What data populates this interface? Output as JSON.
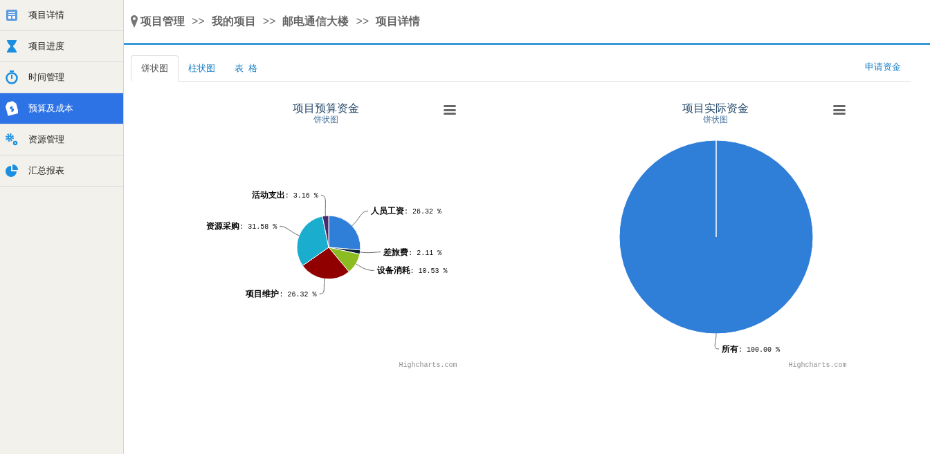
{
  "sidebar": {
    "items": [
      {
        "label": "项目详情",
        "selected": false
      },
      {
        "label": "项目进度",
        "selected": false
      },
      {
        "label": "时间管理",
        "selected": false
      },
      {
        "label": "预算及成本",
        "selected": true
      },
      {
        "label": "资源管理",
        "selected": false
      },
      {
        "label": "汇总报表",
        "selected": false
      }
    ]
  },
  "breadcrumb": {
    "items": [
      "项目管理",
      "我的项目",
      "邮电通信大楼",
      "项目详情"
    ],
    "separator": ">>"
  },
  "tabs": [
    {
      "label": "饼状图",
      "selected": true
    },
    {
      "label": "柱状图",
      "selected": false
    },
    {
      "label": "表  格",
      "selected": false
    }
  ],
  "apply_link": "申请资金",
  "charts": [
    {
      "subtitle": "饼状图",
      "credits": "Highcharts.com",
      "chart_data": {
        "type": "pie",
        "title": "项目预算资金",
        "data_labels": true,
        "categories": [
          "人员工资",
          "差旅费",
          "设备消耗",
          "项目维护",
          "资源采购",
          "活动支出"
        ],
        "values": [
          26.32,
          2.11,
          10.53,
          26.32,
          31.58,
          3.16
        ],
        "value_labels": [
          ": 26.32 %",
          ": 2.11 %",
          ": 10.53 %",
          ": 26.32 %",
          ": 31.58 %",
          ": 3.16 %"
        ],
        "colors": [
          "#2f7ed8",
          "#0d233a",
          "#8bbc21",
          "#910000",
          "#1aadce",
          "#492970"
        ]
      }
    },
    {
      "subtitle": "饼状图",
      "credits": "Highcharts.com",
      "chart_data": {
        "type": "pie",
        "title": "项目实际资金",
        "data_labels": true,
        "categories": [
          "所有"
        ],
        "values": [
          100
        ],
        "value_labels": [
          ": 100.00 %"
        ],
        "colors": [
          "#2f7ed8"
        ]
      }
    }
  ]
}
